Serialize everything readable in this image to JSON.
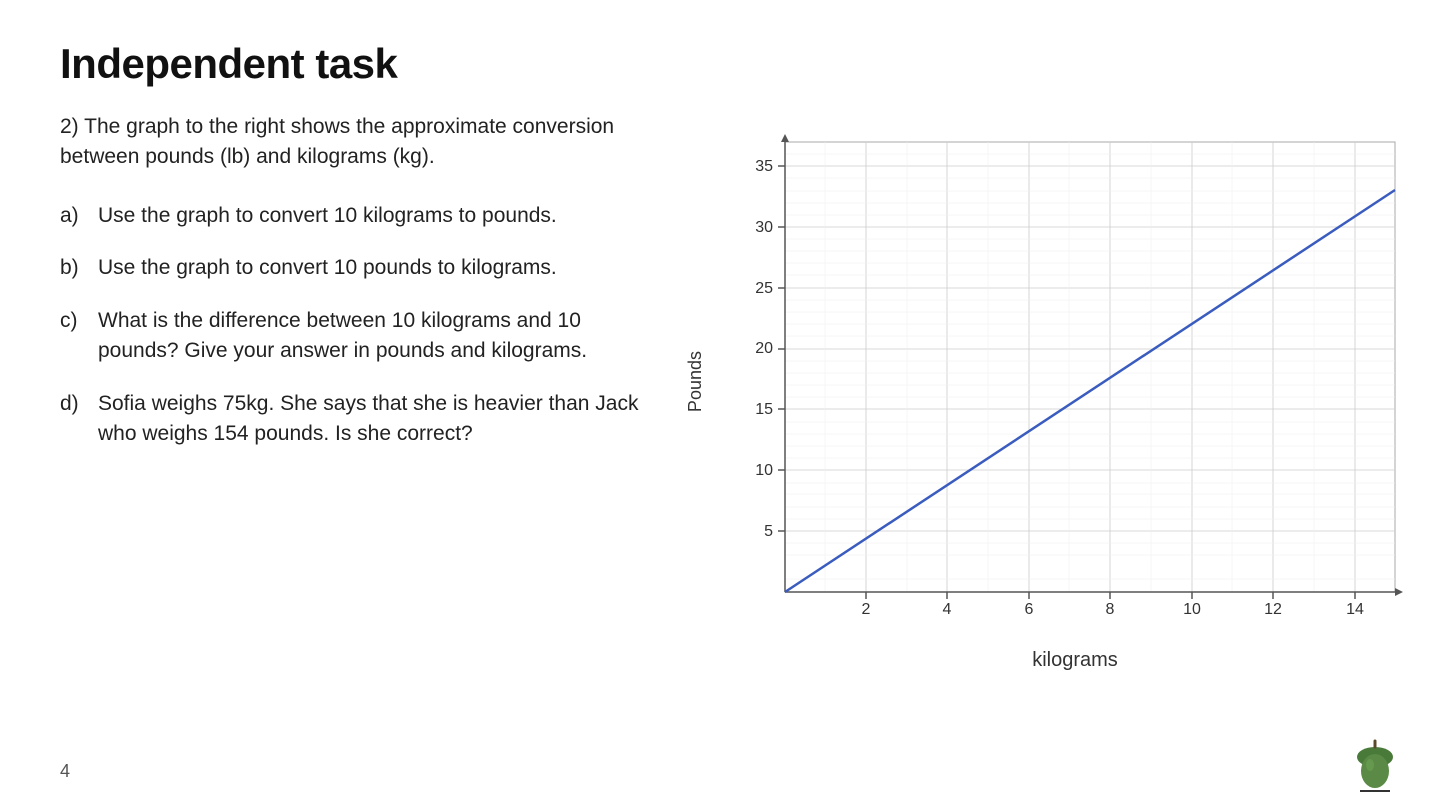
{
  "page": {
    "title": "Independent task",
    "page_number": "4",
    "intro": "2) The graph to the right shows the approximate conversion between pounds (lb) and kilograms (kg).",
    "questions": [
      {
        "label": "a)",
        "text": "Use the graph to convert 10 kilograms to pounds."
      },
      {
        "label": "b)",
        "text": "Use the graph to convert 10 pounds to kilograms."
      },
      {
        "label": "c)",
        "text": "What is the difference between 10 kilograms and 10 pounds? Give your answer in pounds and kilograms."
      },
      {
        "label": "d)",
        "text": "Sofia weighs 75kg. She says that she is heavier than Jack who weighs 154 pounds. Is she correct?"
      }
    ],
    "graph": {
      "x_label": "kilograms",
      "y_label": "Pounds",
      "x_ticks": [
        2,
        4,
        6,
        8,
        10,
        12,
        14
      ],
      "y_ticks": [
        5,
        10,
        15,
        20,
        25,
        30,
        35
      ],
      "line_color": "#3a5cbf",
      "line_start": {
        "x": 0,
        "y": 0
      },
      "line_end": {
        "x": 15,
        "y": 33
      }
    }
  }
}
